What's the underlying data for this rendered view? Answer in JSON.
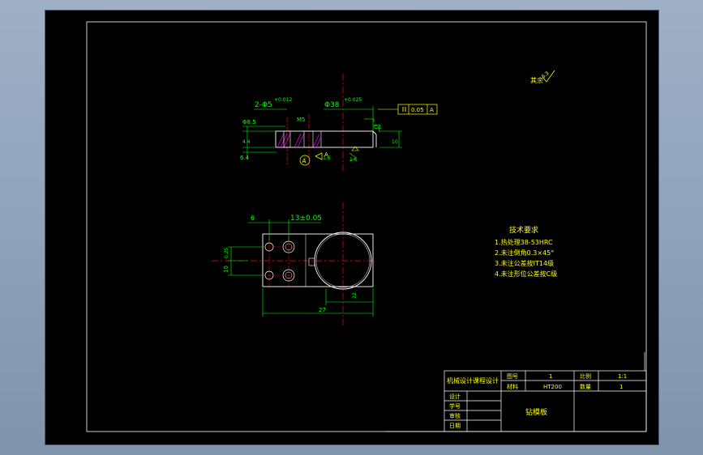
{
  "colors": {
    "background": "#000000",
    "border": "#ffffff",
    "outline": "#ffffff",
    "dimension": "#00ff00",
    "centerline": "#ff0000",
    "text_yellow": "#ffff00",
    "hatch": "#ff00ff",
    "datum": "#ffff00"
  },
  "section_view": {
    "holes_dim": "2-Φ5",
    "holes_tol": "+0.012",
    "bore_dim": "Φ38",
    "bore_tol": "+0.025",
    "counterbore_dim": "Φ8.5",
    "thread_dim": "M5",
    "depth_small": "4.4",
    "depth_large": "6.4",
    "chamfer": "C1",
    "thickness": "10",
    "roughness_a": "1.6",
    "roughness_b": "1.6",
    "datum_letter": "A",
    "geo_tol_value": "0.05",
    "geo_tol_datum": "A",
    "section_label": "A"
  },
  "plan_view": {
    "dim_left": "6",
    "dim_top": "13±0.05",
    "dim_vertical": "10",
    "dim_vertical_b": "0.25",
    "dim_bottom_total": "27",
    "dim_bottom_partial": "22"
  },
  "roughness_note": {
    "label": "其余",
    "value": "6.3"
  },
  "tech_requirements": {
    "title": "技术要求",
    "items": [
      "1.热处理38-53HRC",
      "2.未注倒角0.3×45°",
      "3.未注公差按IT14级",
      "4.未注形位公差按C级"
    ]
  },
  "title_block": {
    "course": "机械设计课程设计",
    "drawing_no_label": "图号",
    "drawing_no": "1",
    "scale_label": "比例",
    "scale": "1:1",
    "material_label": "材料",
    "material": "HT200",
    "quantity_label": "数量",
    "quantity": "1",
    "part_name": "钻模板",
    "rows": [
      "设计",
      "学号",
      "审核",
      "日期"
    ]
  }
}
